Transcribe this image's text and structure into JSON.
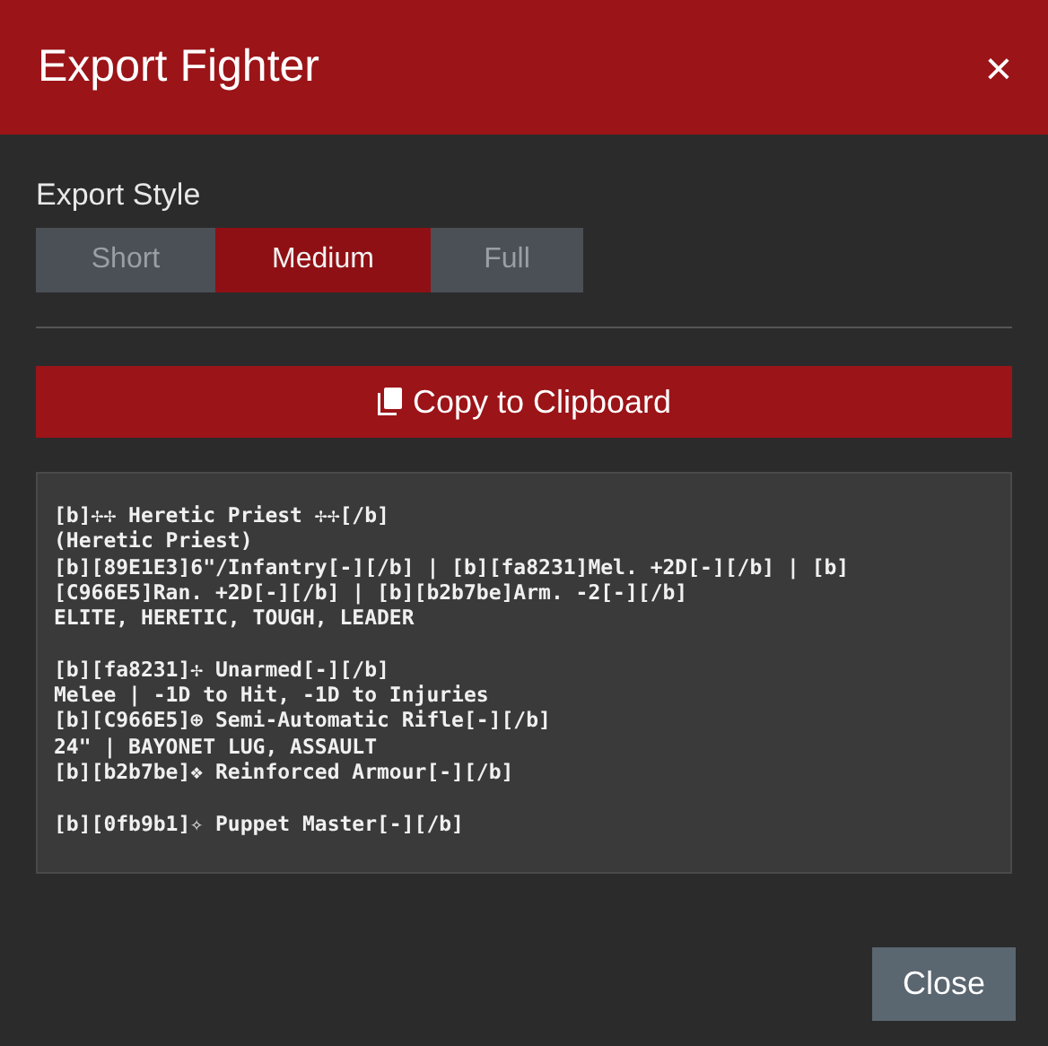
{
  "dialog": {
    "title": "Export Fighter",
    "close_icon": "×"
  },
  "export_style": {
    "label": "Export Style",
    "options": [
      {
        "label": "Short",
        "selected": false
      },
      {
        "label": "Medium",
        "selected": true
      },
      {
        "label": "Full",
        "selected": false
      }
    ]
  },
  "copy_button": {
    "label": "Copy to Clipboard"
  },
  "export_text": "[b]✢✢ Heretic Priest ✢✢[/b]\n(Heretic Priest)\n[b][89E1E3]6\"/Infantry[-][/b] | [b][fa8231]Mel. +2D[-][/b] | [b]\n[C966E5]Ran. +2D[-][/b] | [b][b2b7be]Arm. -2[-][/b]\nELITE, HERETIC, TOUGH, LEADER\n\n[b][fa8231]✢ Unarmed[-][/b]\nMelee | -1D to Hit, -1D to Injuries\n[b][C966E5]⊕ Semi-Automatic Rifle[-][/b]\n24\" | BAYONET LUG, ASSAULT\n[b][b2b7be]❖ Reinforced Armour[-][/b]\n\n[b][0fb9b1]✧ Puppet Master[-][/b]",
  "footer": {
    "close_button": "Close"
  }
}
